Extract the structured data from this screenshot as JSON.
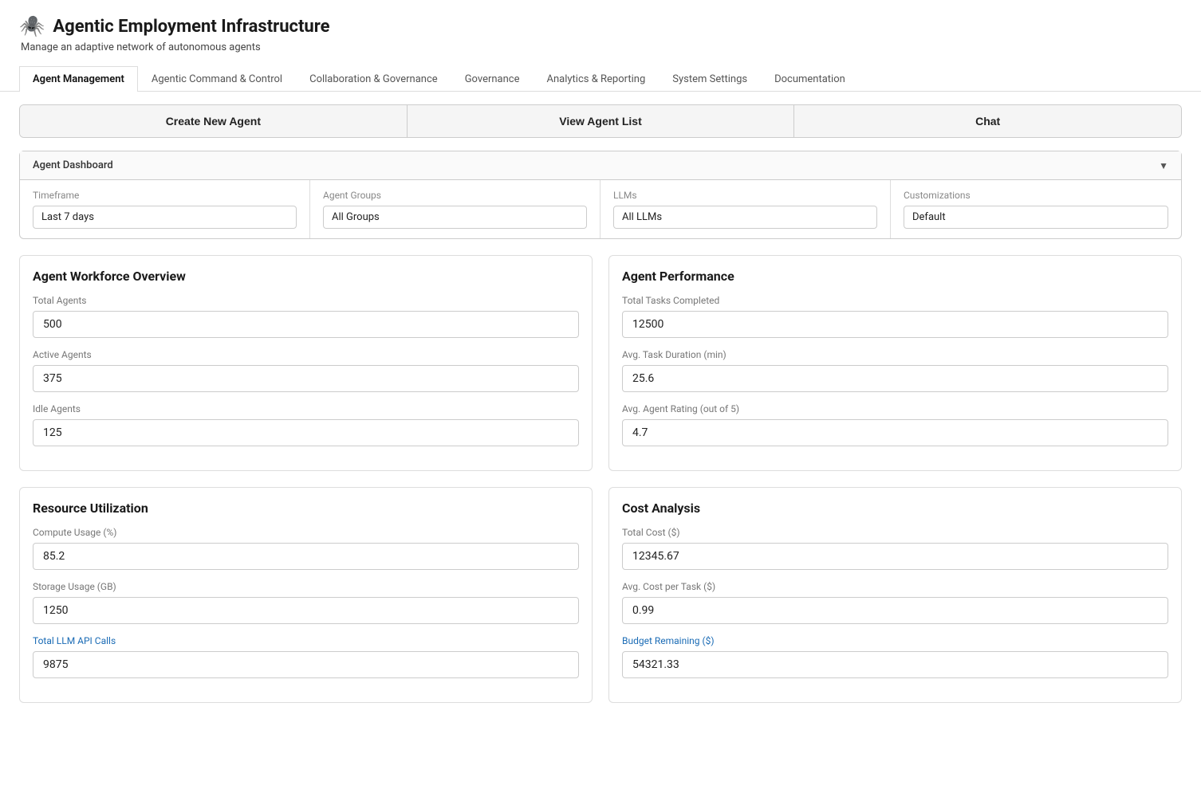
{
  "app": {
    "icon": "🕷️",
    "title": "Agentic Employment Infrastructure",
    "subtitle": "Manage an adaptive network of autonomous agents"
  },
  "tabs": [
    {
      "label": "Agent Management",
      "active": true
    },
    {
      "label": "Agentic Command & Control",
      "active": false
    },
    {
      "label": "Collaboration & Governance",
      "active": false
    },
    {
      "label": "Governance",
      "active": false
    },
    {
      "label": "Analytics & Reporting",
      "active": false
    },
    {
      "label": "System Settings",
      "active": false
    },
    {
      "label": "Documentation",
      "active": false
    }
  ],
  "action_buttons": {
    "create": "Create New Agent",
    "view": "View Agent List",
    "chat": "Chat"
  },
  "dashboard": {
    "title": "Agent Dashboard",
    "arrow": "▼",
    "filters": {
      "timeframe_label": "Timeframe",
      "timeframe_value": "Last 7 days",
      "agent_groups_label": "Agent Groups",
      "agent_groups_value": "All Groups",
      "llms_label": "LLMs",
      "llms_value": "All LLMs",
      "customizations_label": "Customizations",
      "customizations_value": "Default"
    }
  },
  "workforce": {
    "title": "Agent Workforce Overview",
    "total_agents_label": "Total Agents",
    "total_agents_value": "500",
    "active_agents_label": "Active Agents",
    "active_agents_value": "375",
    "idle_agents_label": "Idle Agents",
    "idle_agents_value": "125"
  },
  "performance": {
    "title": "Agent Performance",
    "tasks_completed_label": "Total Tasks Completed",
    "tasks_completed_value": "12500",
    "avg_duration_label": "Avg. Task Duration (min)",
    "avg_duration_value": "25.6",
    "avg_rating_label": "Avg. Agent Rating (out of 5)",
    "avg_rating_value": "4.7"
  },
  "resource": {
    "title": "Resource Utilization",
    "compute_label": "Compute Usage (%)",
    "compute_value": "85.2",
    "storage_label": "Storage Usage (GB)",
    "storage_value": "1250",
    "llm_api_label": "Total LLM API Calls",
    "llm_api_value": "9875"
  },
  "cost": {
    "title": "Cost Analysis",
    "total_cost_label": "Total Cost ($)",
    "total_cost_value": "12345.67",
    "avg_cost_label": "Avg. Cost per Task ($)",
    "avg_cost_value": "0.99",
    "budget_label": "Budget Remaining ($)",
    "budget_value": "54321.33"
  }
}
